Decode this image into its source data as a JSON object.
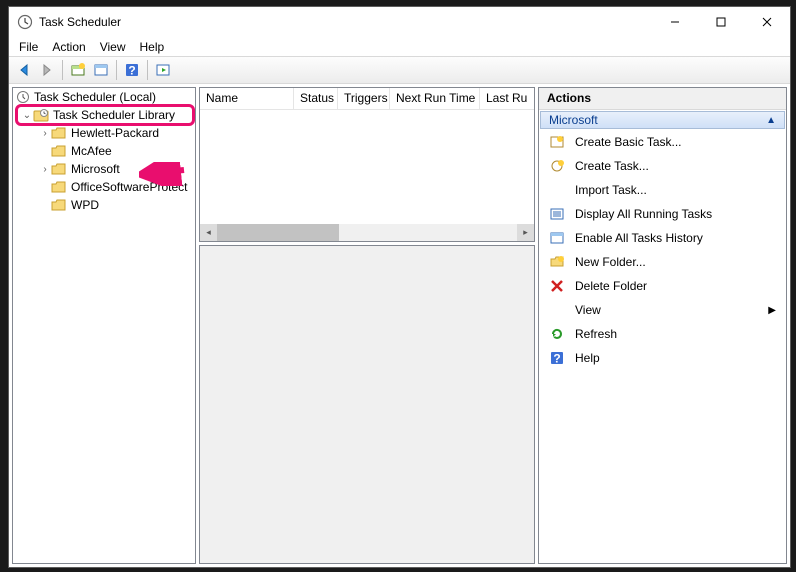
{
  "window": {
    "title": "Task Scheduler"
  },
  "menu": {
    "file": "File",
    "action": "Action",
    "view": "View",
    "help": "Help"
  },
  "tree": {
    "root": "Task Scheduler (Local)",
    "library": "Task Scheduler Library",
    "items": {
      "hp": "Hewlett-Packard",
      "mcafee": "McAfee",
      "microsoft": "Microsoft",
      "osp": "OfficeSoftwareProtect",
      "wpd": "WPD"
    }
  },
  "list_columns": {
    "name": "Name",
    "status": "Status",
    "triggers": "Triggers",
    "next_run": "Next Run Time",
    "last_run": "Last Ru"
  },
  "actions": {
    "header": "Actions",
    "context": "Microsoft",
    "items": {
      "create_basic": "Create Basic Task...",
      "create_task": "Create Task...",
      "import_task": "Import Task...",
      "display_running": "Display All Running Tasks",
      "enable_history": "Enable All Tasks History",
      "new_folder": "New Folder...",
      "delete_folder": "Delete Folder",
      "view": "View",
      "refresh": "Refresh",
      "help": "Help"
    }
  }
}
